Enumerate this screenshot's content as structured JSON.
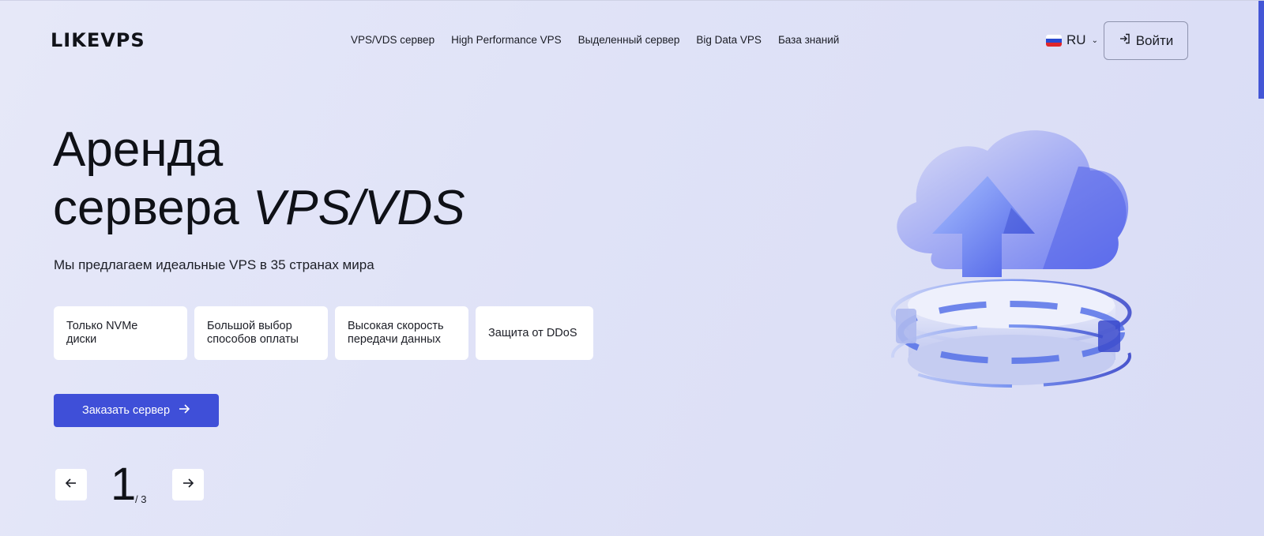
{
  "header": {
    "logo": "LIKEVPS",
    "nav": [
      {
        "label": "VPS/VDS сервер"
      },
      {
        "label": "High Performance VPS"
      },
      {
        "label": "Выделенный сервер"
      },
      {
        "label": "Big Data VPS"
      },
      {
        "label": "База знаний"
      }
    ],
    "language": "RU",
    "login_label": "Войти"
  },
  "hero": {
    "title_line1": "Аренда",
    "title_line2": "сервера",
    "title_accent": "VPS/VDS",
    "subtitle": "Мы предлагаем идеальные VPS в 35 странах мира",
    "features": [
      {
        "label": "Только NVMe диски"
      },
      {
        "label": "Большой выбор способов оплаты"
      },
      {
        "label": "Высокая скорость передачи данных"
      },
      {
        "label": "Защита от DDoS"
      }
    ],
    "cta_label": "Заказать сервер"
  },
  "slider": {
    "current": "1",
    "total": "/ 3"
  },
  "icons": {
    "login": "login-icon",
    "arrow_right": "arrow-right-icon",
    "arrow_left": "arrow-left-icon",
    "flag": "russia-flag-icon",
    "chevron": "chevron-down-icon"
  },
  "colors": {
    "accent": "#3f4fd8",
    "background": "#e2e4f7",
    "card": "#ffffff",
    "scrollbar": "#4356d6"
  }
}
